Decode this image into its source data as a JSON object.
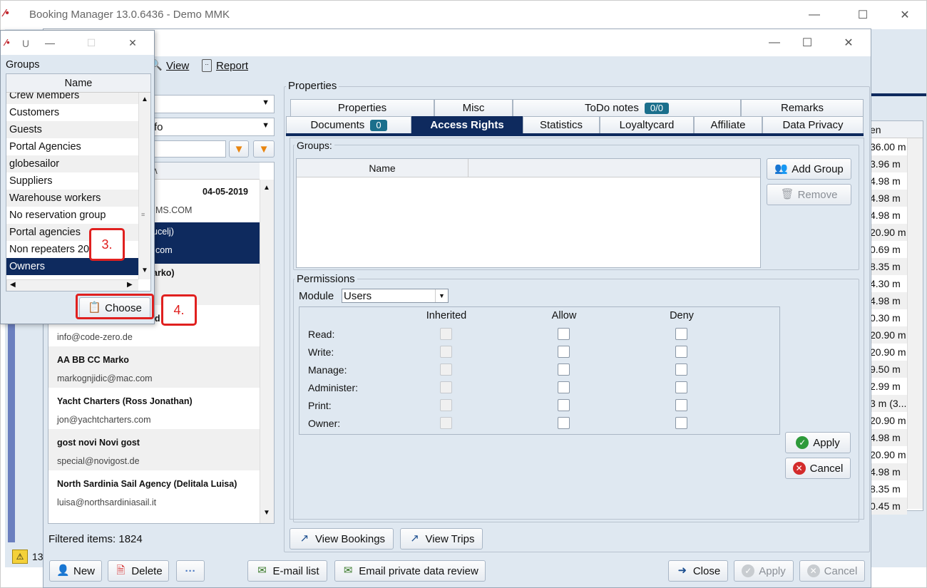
{
  "main_window": {
    "title": "Booking Manager 13.0.6436 - Demo MMK"
  },
  "toolbar": {
    "view": "View",
    "report": "Report"
  },
  "groups_popup": {
    "title": "U",
    "groups_label": "Groups",
    "column_name": "Name",
    "items": [
      "Crew Members",
      "Customers",
      "Guests",
      "Portal Agencies",
      "globesailor",
      "Suppliers",
      "Warehouse workers",
      "No reservation group",
      "Portal agencies",
      "Non repeaters 20",
      "Owners"
    ],
    "choose_label": "Choose"
  },
  "annotations": {
    "step3": "3.",
    "step4": "4."
  },
  "left_panel": {
    "combo2_partial": "fo",
    "date": "04-05-2019",
    "email_partial_1": "MS.COM",
    "name_partial_2": "ucelj)",
    "email_partial_2": "com",
    "name_partial_3": "arko)",
    "col_partial": "e ∧",
    "entries": [
      {
        "name": "Code Zero (Raderscheid Dirk)",
        "email": "info@code-zero.de"
      },
      {
        "name": "AA BB CC Marko",
        "email": "markognjidic@mac.com"
      },
      {
        "name": " Yacht Charters (Ross Jonathan)",
        "email": "jon@yachtcharters.com"
      },
      {
        "name": "gost novi Novi gost",
        "email": "special@novigost.de"
      },
      {
        "name": "North Sardinia Sail Agency (Delitala Luisa)",
        "email": "luisa@northsardiniasail.it"
      }
    ],
    "filtered": "Filtered items: 1824",
    "status_partial": "13"
  },
  "properties": {
    "label": "Properties",
    "tabs_row1": [
      {
        "label": "Properties"
      },
      {
        "label": "Misc"
      },
      {
        "label": "ToDo notes",
        "badge": "0/0"
      },
      {
        "label": "Remarks"
      }
    ],
    "tabs_row2": [
      {
        "label": "Documents",
        "badge": "0"
      },
      {
        "label": "Access Rights"
      },
      {
        "label": "Statistics"
      },
      {
        "label": "Loyaltycard"
      },
      {
        "label": "Affiliate"
      },
      {
        "label": "Data Privacy"
      }
    ],
    "groups_label": "Groups:",
    "groups_col": "Name",
    "add_group": "Add Group",
    "remove": "Remove",
    "permissions_label": "Permissions",
    "module_label": "Module",
    "module_value": "Users",
    "perm_cols": [
      "Inherited",
      "Allow",
      "Deny"
    ],
    "perm_rows": [
      "Read:",
      "Write:",
      "Manage:",
      "Administer:",
      "Print:",
      "Owner:"
    ],
    "apply": "Apply",
    "cancel": "Cancel",
    "view_bookings": "View Bookings",
    "view_trips": "View Trips"
  },
  "bottom": {
    "new": "New",
    "delete": "Delete",
    "more": "···",
    "email_list": "E-mail list",
    "email_private": "Email private data review",
    "close": "Close",
    "apply": "Apply",
    "cancel": "Cancel"
  },
  "right_bg": {
    "header": "en",
    "values": [
      "36.00 m",
      "3.96 m",
      "4.98 m",
      "4.98 m",
      "4.98 m",
      "20.90 m",
      "0.69 m",
      "8.35 m",
      "4.30 m",
      "4.98 m",
      "0.30 m",
      "20.90 m",
      "20.90 m",
      "9.50 m",
      "2.99 m",
      "3 m (3...",
      "20.90 m",
      "4.98 m",
      "20.90 m",
      "4.98 m",
      "8.35 m",
      "0.45 m"
    ]
  }
}
